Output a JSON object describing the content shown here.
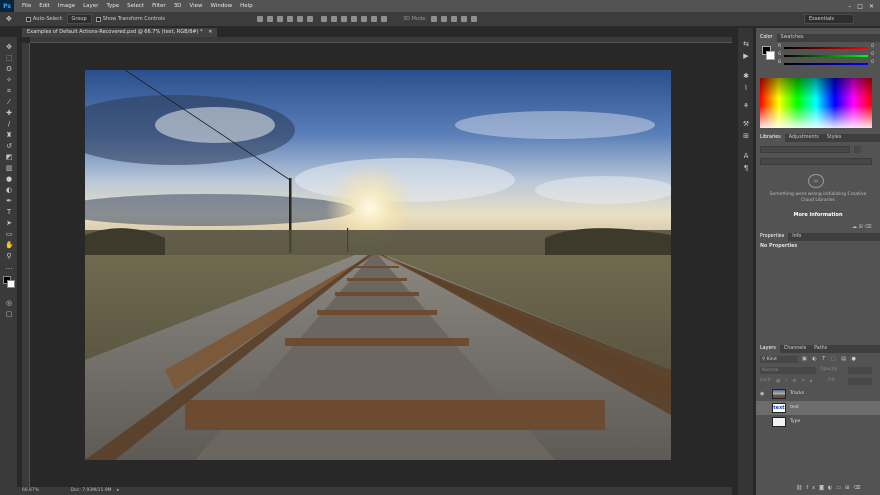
{
  "app": {
    "logo": "Ps"
  },
  "menu": [
    "File",
    "Edit",
    "Image",
    "Layer",
    "Type",
    "Select",
    "Filter",
    "3D",
    "View",
    "Window",
    "Help"
  ],
  "options": {
    "auto_select": "Auto-Select:",
    "group": "Group",
    "transform": "Show Transform Controls",
    "mode3d": "3D Mode:",
    "workspace": "Essentials"
  },
  "document": {
    "tab_title": "Examples of Default Actions-Recovered.psd @ 66.7% (text, RGB/8#) *",
    "zoom": "66.67%",
    "doc_info": "Doc: 7.93M/11.9M"
  },
  "color_panel": {
    "tabs": [
      "Color",
      "Swatches"
    ],
    "r": "0",
    "g": "0",
    "b": "0"
  },
  "libraries_panel": {
    "tabs": [
      "Libraries",
      "Adjustments",
      "Styles"
    ],
    "message": "Something went wrong initializing Creative Cloud Libraries",
    "more_info": "More information"
  },
  "properties_panel": {
    "tabs": [
      "Properties",
      "Info"
    ],
    "message": "No Properties"
  },
  "layers_panel": {
    "tabs": [
      "Layers",
      "Channels",
      "Paths"
    ],
    "kind": "Kind",
    "blend": "Normal",
    "opacity_label": "Opacity:",
    "fill_label": "Fill:",
    "lock_label": "Lock:",
    "layers": [
      {
        "name": "Tracks",
        "thumb": ""
      },
      {
        "name": "text",
        "thumb": "text"
      },
      {
        "name": "Type",
        "thumb": ""
      }
    ]
  },
  "colors": {
    "accent": "#31a8ff",
    "hue_red": "#ff0000"
  }
}
